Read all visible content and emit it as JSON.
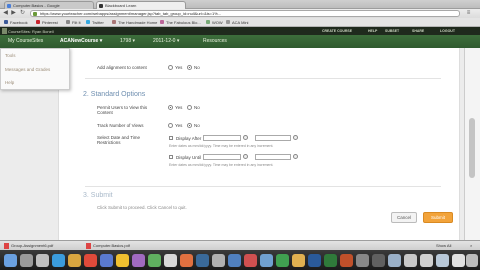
{
  "browser": {
    "tabs": [
      {
        "label": "Computer.Basics - Google",
        "active": false
      },
      {
        "label": "Blackboard Learn",
        "active": true
      }
    ],
    "url": "https://www.yourteacher.com/webapps/assignment/manager.jsp?tab_tab_group_id=null&url=&is=1%...",
    "bookmarks": [
      "Facebook",
      "Pinterest",
      "Flit It",
      "Twitter",
      "The Handmade Home",
      "The Fabulous Blo...",
      "WOW",
      "ACA Mini"
    ]
  },
  "site": {
    "user_label": "CourseSites: Ryan Bonell",
    "top_links": [
      "CREATE COURSE",
      "HELP",
      "SUBSET",
      "SHARE",
      "LOGOUT"
    ],
    "nav": [
      "My CourseSites",
      "ACANewCourse ▾",
      "1798 ▾",
      "2011-12-0 ▾",
      "Resources"
    ],
    "dropdown_items": [
      "Tools",
      "Messages and Grades",
      "Help"
    ]
  },
  "form": {
    "row_add_alignment": {
      "label": "Add alignment to content",
      "yes": "Yes",
      "no": "No"
    },
    "section2": {
      "number": "2.",
      "title": "Standard Options"
    },
    "permit": {
      "label": "Permit Users to View this Content",
      "yes": "Yes",
      "no": "No"
    },
    "track": {
      "label": "Track Number of Views",
      "yes": "Yes",
      "no": "No"
    },
    "select_dates": {
      "label": "Select Date and Time Restrictions"
    },
    "display_after": {
      "label": "Display After",
      "hint": "Enter dates as mm/dd/yyyy. Time may be entered in any increment."
    },
    "display_until": {
      "label": "Display Until",
      "hint": "Enter dates as mm/dd/yyyy. Time may be entered in any increment."
    },
    "section3": {
      "number": "3.",
      "title": "Submit"
    },
    "submit_hint": "Click Submit to proceed. Click Cancel to quit.",
    "cancel_label": "Cancel",
    "submit_label": "Submit"
  },
  "downloads": [
    {
      "label": "Group-Assignment6.pdf"
    },
    {
      "label": "Computer.Basics.pdf"
    }
  ],
  "downloads_show_all": "Show All",
  "colors": {
    "nav_green": "#2f5a2f",
    "submit_orange": "#f2a33a",
    "section_blue": "#6f8fb0"
  }
}
